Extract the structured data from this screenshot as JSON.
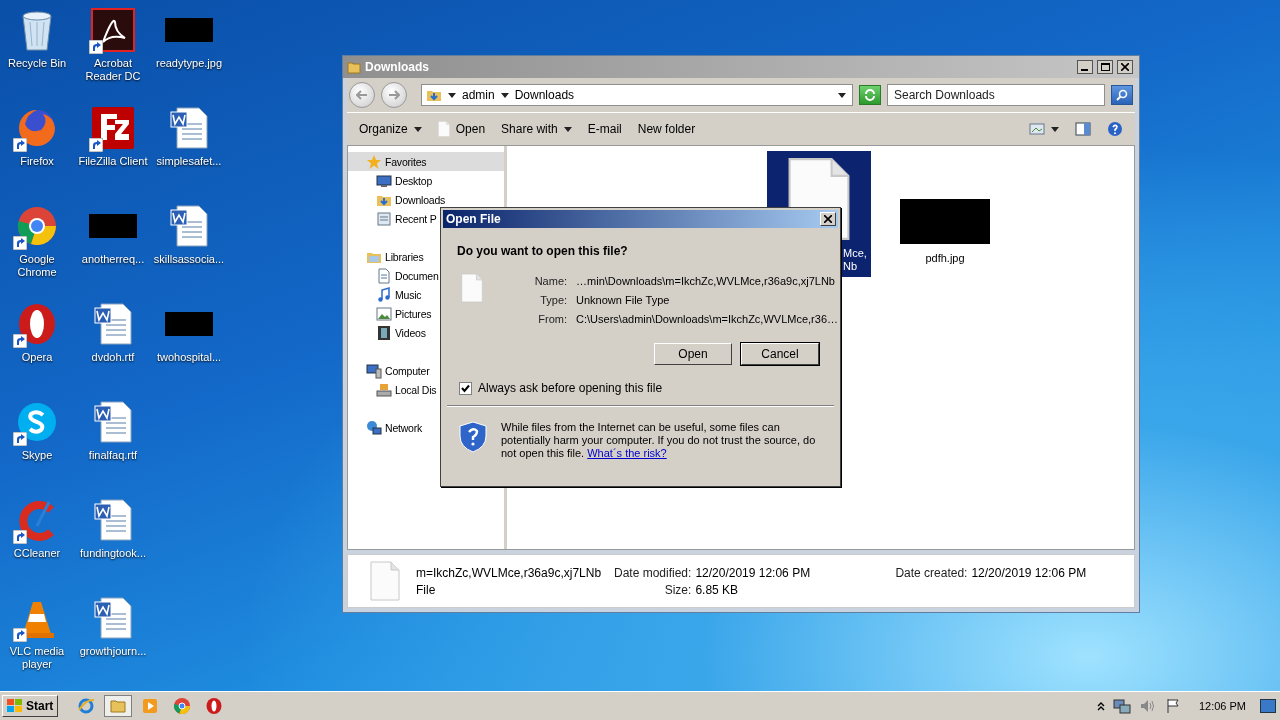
{
  "desktop_icons": [
    {
      "label": "Recycle Bin",
      "kind": "recycle",
      "shortcut": false
    },
    {
      "label": "Firefox",
      "kind": "firefox",
      "shortcut": true
    },
    {
      "label": "Google Chrome",
      "kind": "chrome",
      "shortcut": true
    },
    {
      "label": "Opera",
      "kind": "opera",
      "shortcut": true
    },
    {
      "label": "Skype",
      "kind": "skype",
      "shortcut": true
    },
    {
      "label": "CCleaner",
      "kind": "ccleaner",
      "shortcut": true
    },
    {
      "label": "VLC media player",
      "kind": "vlc",
      "shortcut": true
    },
    {
      "label": "Acrobat Reader DC",
      "kind": "acrobat",
      "shortcut": true
    },
    {
      "label": "FileZilla Client",
      "kind": "filezilla",
      "shortcut": true
    },
    {
      "label": "anotherreq...",
      "kind": "redacted",
      "shortcut": false
    },
    {
      "label": "dvdoh.rtf",
      "kind": "word",
      "shortcut": false
    },
    {
      "label": "finalfaq.rtf",
      "kind": "word",
      "shortcut": false
    },
    {
      "label": "fundingtook...",
      "kind": "word",
      "shortcut": false
    },
    {
      "label": "growthjourn...",
      "kind": "word",
      "shortcut": false
    },
    {
      "label": "readytype.jpg",
      "kind": "redacted",
      "shortcut": false
    },
    {
      "label": "simplesafet...",
      "kind": "word",
      "shortcut": false
    },
    {
      "label": "skillsassocia...",
      "kind": "word",
      "shortcut": false
    },
    {
      "label": "twohospital...",
      "kind": "redacted",
      "shortcut": false
    }
  ],
  "explorer": {
    "title": "Downloads",
    "breadcrumb": [
      "admin",
      "Downloads"
    ],
    "search": {
      "placeholder": "Search Downloads"
    },
    "toolbar": [
      {
        "label": "Organize",
        "kind": "dropdown"
      },
      {
        "label": "Open",
        "kind": "file"
      },
      {
        "label": "Share with",
        "kind": "dropdown"
      },
      {
        "label": "E-mail",
        "kind": "plain"
      },
      {
        "label": "New folder",
        "kind": "plain"
      }
    ],
    "nav": [
      {
        "label": "Favorites",
        "kind": "star",
        "selected": true,
        "children": [
          {
            "label": "Desktop",
            "kind": "desktop",
            "selected": false
          },
          {
            "label": "Downloads",
            "kind": "downloads",
            "selected": false
          },
          {
            "label": "Recent P",
            "kind": "recent",
            "selected": false
          }
        ]
      },
      {
        "label": "Libraries",
        "kind": "libraries",
        "selected": false,
        "children": [
          {
            "label": "Documen",
            "kind": "documents",
            "selected": false
          },
          {
            "label": "Music",
            "kind": "music",
            "selected": false
          },
          {
            "label": "Pictures",
            "kind": "pictures",
            "selected": false
          },
          {
            "label": "Videos",
            "kind": "videos",
            "selected": false
          }
        ]
      },
      {
        "label": "Computer",
        "kind": "computer",
        "selected": false,
        "children": [
          {
            "label": "Local Dis",
            "kind": "disk",
            "selected": false
          }
        ]
      },
      {
        "label": "Network",
        "kind": "network",
        "selected": false
      }
    ],
    "files": [
      {
        "lines": [
          "Mce,",
          "Nb"
        ],
        "kind": "document",
        "selected": true
      },
      {
        "lines": [
          "pdfh.jpg"
        ],
        "kind": "redacted",
        "selected": false
      }
    ],
    "details": {
      "name": "m=IkchZc,WVLMce,r36a9c,xj7LNb",
      "type": "File",
      "fields": [
        {
          "label": "Date modified:",
          "value": "12/20/2019 12:06 PM"
        },
        {
          "label": "Size:",
          "value": "6.85 KB"
        },
        {
          "label": "Date created:",
          "value": "12/20/2019 12:06 PM"
        }
      ]
    }
  },
  "dialog": {
    "title": "Open File",
    "question": "Do you want to open this file?",
    "fields": [
      {
        "label": "Name:",
        "value": "…min\\Downloads\\m=IkchZc,WVLMce,r36a9c,xj7LNb"
      },
      {
        "label": "Type:",
        "value": "Unknown File Type"
      },
      {
        "label": "From:",
        "value": "C:\\Users\\admin\\Downloads\\m=IkchZc,WVLMce,r36…"
      }
    ],
    "buttons": [
      {
        "label": "Open",
        "default": false
      },
      {
        "label": "Cancel",
        "default": true
      }
    ],
    "checkbox": {
      "label": "Always ask before opening this file",
      "checked": true
    },
    "warning": "While files from the Internet can be useful, some files can potentially harm your computer. If you do not trust the source, do not open this file.",
    "link": "What´s the risk?"
  },
  "taskbar": {
    "start": "Start",
    "apps": [
      {
        "kind": "ie",
        "selected": false
      },
      {
        "kind": "explorer",
        "selected": true
      },
      {
        "kind": "media",
        "selected": false
      },
      {
        "kind": "chrome",
        "selected": false
      },
      {
        "kind": "opera",
        "selected": false
      }
    ],
    "clock": "12:06 PM"
  }
}
